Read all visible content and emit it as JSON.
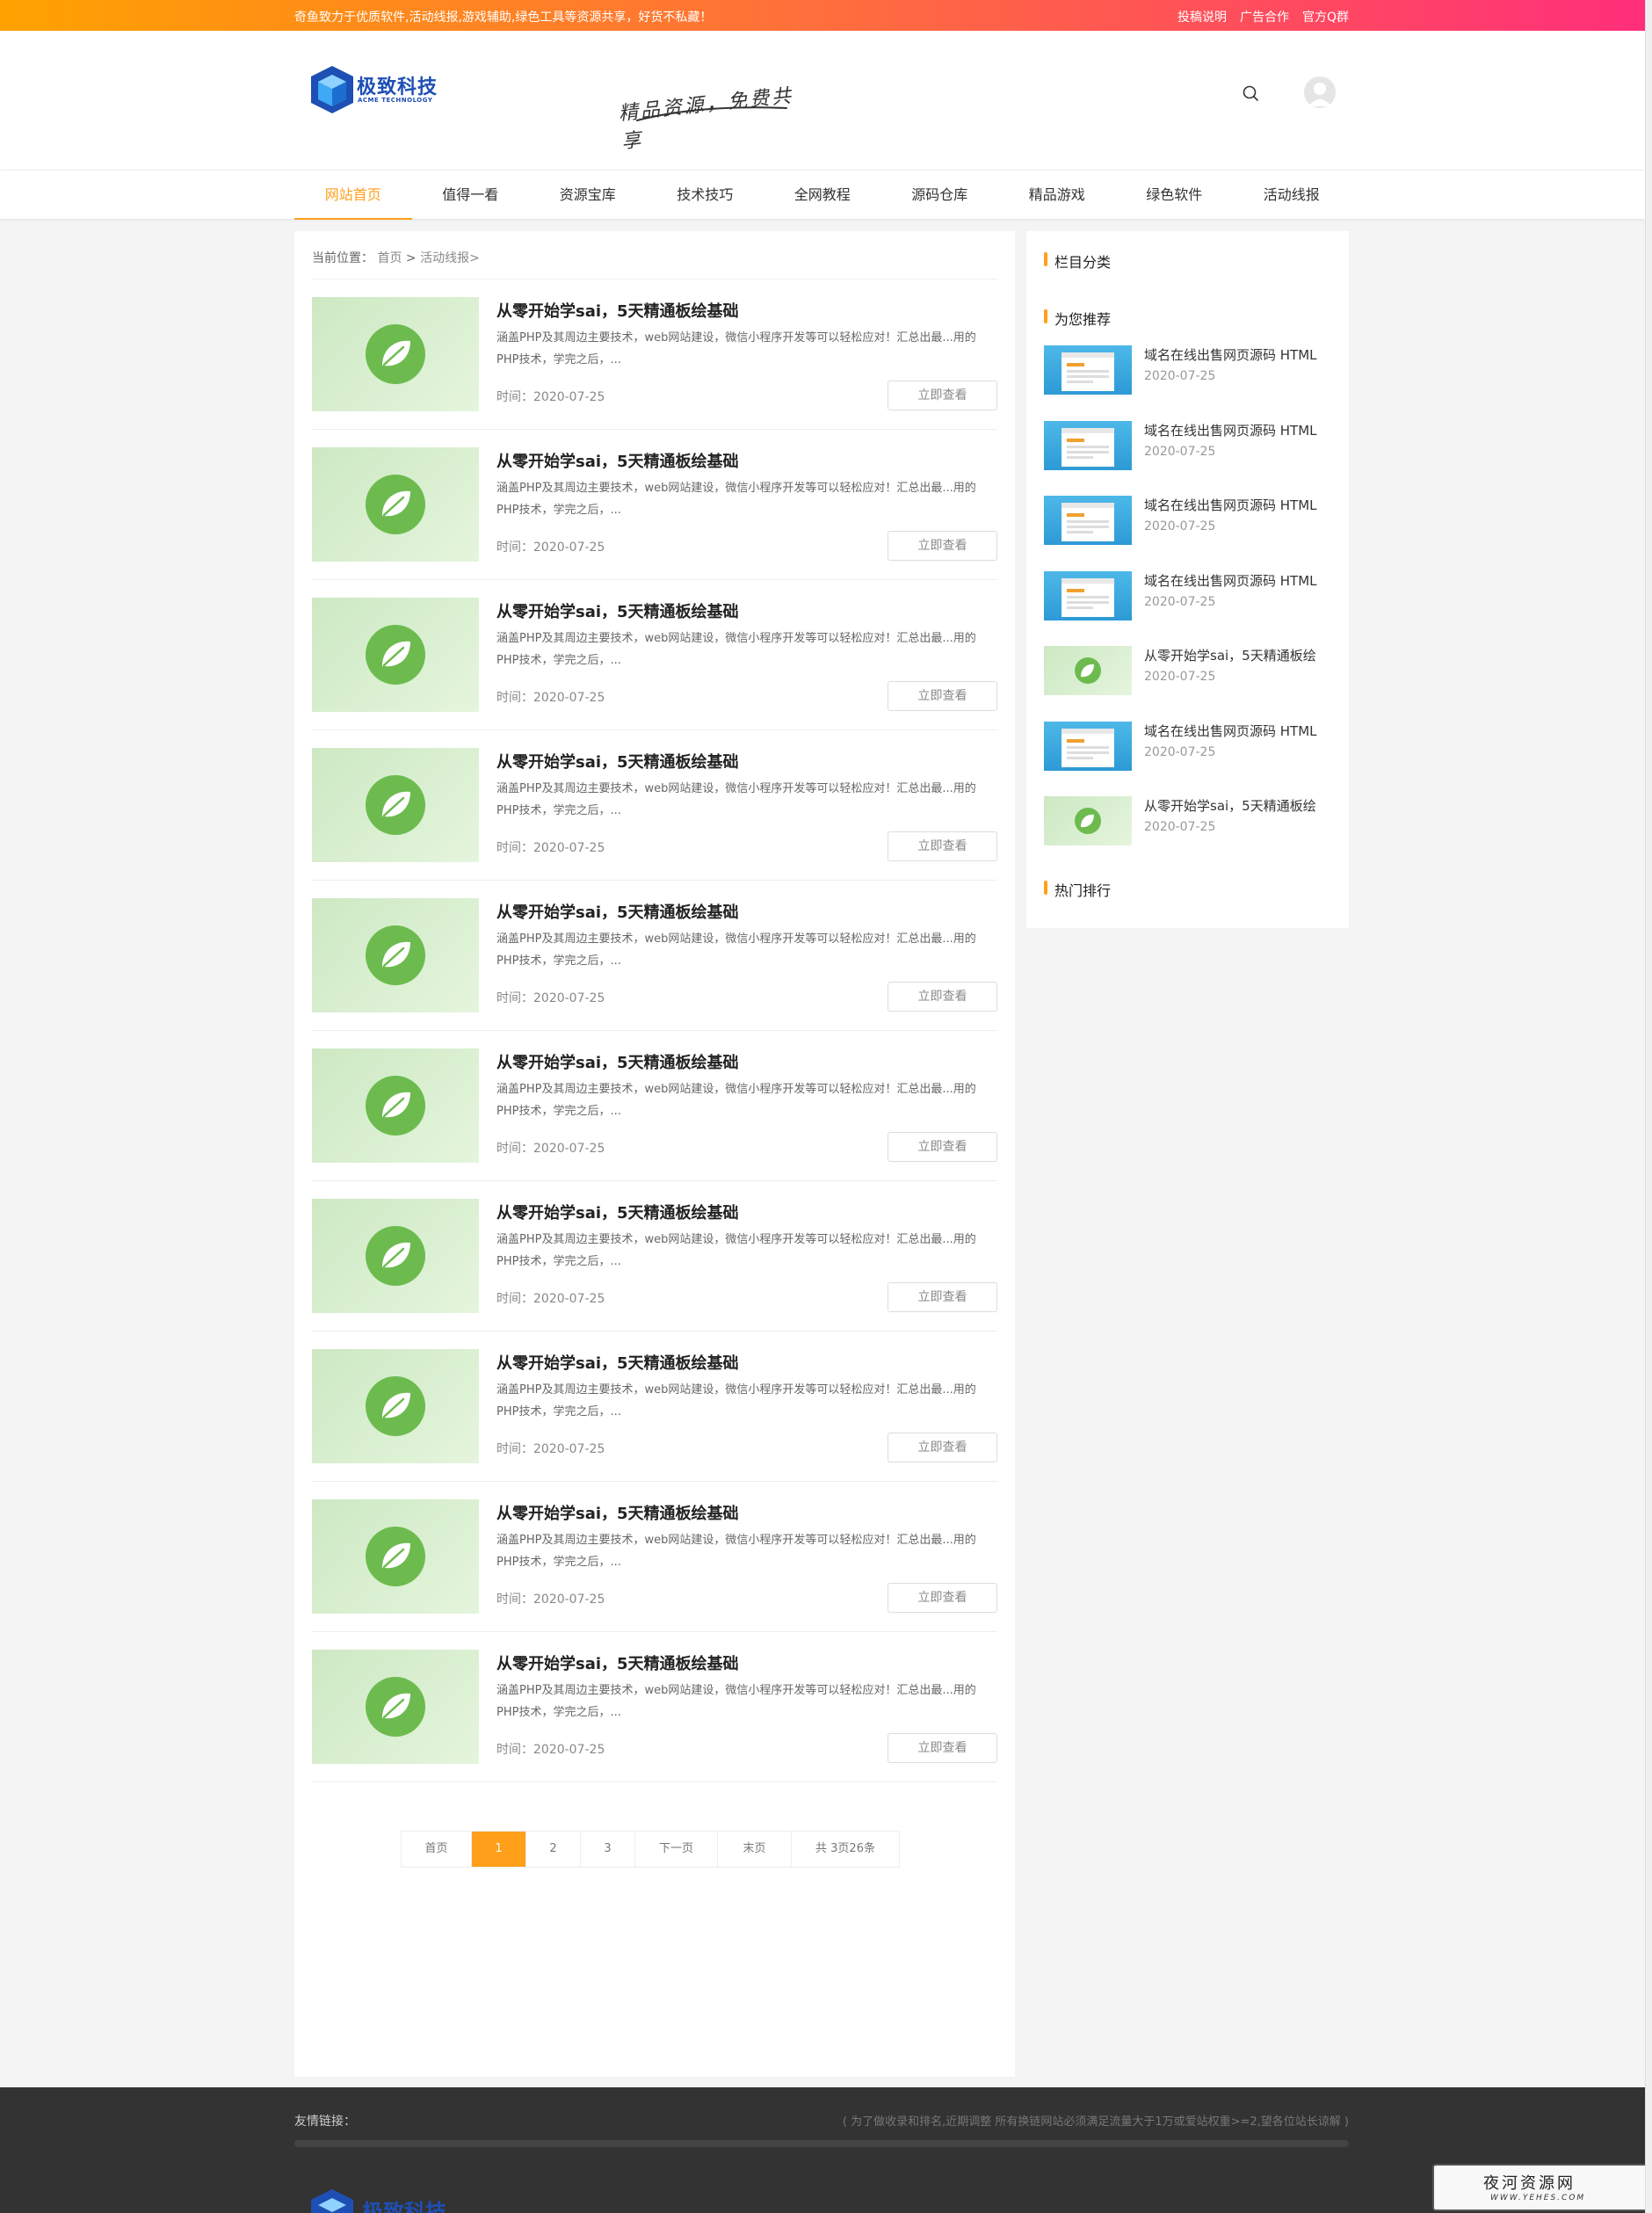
{
  "topbar": {
    "slogan": "奇鱼致力于优质软件,活动线报,游戏辅助,绿色工具等资源共享，好货不私藏！",
    "links": [
      "投稿说明",
      "广告合作",
      "官方Q群"
    ]
  },
  "header": {
    "logo_text": "极致科技",
    "logo_sub": "ACME TECHNOLOGY",
    "slogan_art": "精品资源，免费共享"
  },
  "nav": {
    "items": [
      "网站首页",
      "值得一看",
      "资源宝库",
      "技术技巧",
      "全网教程",
      "源码仓库",
      "精品游戏",
      "绿色软件",
      "活动线报"
    ]
  },
  "breadcrumb": {
    "label": "当前位置：",
    "home": "首页",
    "sep": ">",
    "current": "活动线报>"
  },
  "posts": [
    {
      "title": "从零开始学sai，5天精通板绘基础",
      "desc": "涵盖PHP及其周边主要技术，web网站建设，微信小程序开发等可以轻松应对！汇总出最...用的PHP技术，学完之后，...",
      "time": "时间：2020-07-25",
      "button": "立即查看"
    },
    {
      "title": "从零开始学sai，5天精通板绘基础",
      "desc": "涵盖PHP及其周边主要技术，web网站建设，微信小程序开发等可以轻松应对！汇总出最...用的PHP技术，学完之后，...",
      "time": "时间：2020-07-25",
      "button": "立即查看"
    },
    {
      "title": "从零开始学sai，5天精通板绘基础",
      "desc": "涵盖PHP及其周边主要技术，web网站建设，微信小程序开发等可以轻松应对！汇总出最...用的PHP技术，学完之后，...",
      "time": "时间：2020-07-25",
      "button": "立即查看"
    },
    {
      "title": "从零开始学sai，5天精通板绘基础",
      "desc": "涵盖PHP及其周边主要技术，web网站建设，微信小程序开发等可以轻松应对！汇总出最...用的PHP技术，学完之后，...",
      "time": "时间：2020-07-25",
      "button": "立即查看"
    },
    {
      "title": "从零开始学sai，5天精通板绘基础",
      "desc": "涵盖PHP及其周边主要技术，web网站建设，微信小程序开发等可以轻松应对！汇总出最...用的PHP技术，学完之后，...",
      "time": "时间：2020-07-25",
      "button": "立即查看"
    },
    {
      "title": "从零开始学sai，5天精通板绘基础",
      "desc": "涵盖PHP及其周边主要技术，web网站建设，微信小程序开发等可以轻松应对！汇总出最...用的PHP技术，学完之后，...",
      "time": "时间：2020-07-25",
      "button": "立即查看"
    },
    {
      "title": "从零开始学sai，5天精通板绘基础",
      "desc": "涵盖PHP及其周边主要技术，web网站建设，微信小程序开发等可以轻松应对！汇总出最...用的PHP技术，学完之后，...",
      "time": "时间：2020-07-25",
      "button": "立即查看"
    },
    {
      "title": "从零开始学sai，5天精通板绘基础",
      "desc": "涵盖PHP及其周边主要技术，web网站建设，微信小程序开发等可以轻松应对！汇总出最...用的PHP技术，学完之后，...",
      "time": "时间：2020-07-25",
      "button": "立即查看"
    },
    {
      "title": "从零开始学sai，5天精通板绘基础",
      "desc": "涵盖PHP及其周边主要技术，web网站建设，微信小程序开发等可以轻松应对！汇总出最...用的PHP技术，学完之后，...",
      "time": "时间：2020-07-25",
      "button": "立即查看"
    },
    {
      "title": "从零开始学sai，5天精通板绘基础",
      "desc": "涵盖PHP及其周边主要技术，web网站建设，微信小程序开发等可以轻松应对！汇总出最...用的PHP技术，学完之后，...",
      "time": "时间：2020-07-25",
      "button": "立即查看"
    }
  ],
  "pagination": {
    "items": [
      "首页",
      "1",
      "2",
      "3",
      "下一页",
      "末页",
      "共 3页26条"
    ],
    "current": "1"
  },
  "sidebar": {
    "categories_title": "栏目分类",
    "recommend_title": "为您推荐",
    "hot_title": "热门排行",
    "recommend": [
      {
        "title": "域名在线出售网页源码 HTML",
        "date": "2020-07-25",
        "thumb": "blue"
      },
      {
        "title": "域名在线出售网页源码 HTML",
        "date": "2020-07-25",
        "thumb": "blue"
      },
      {
        "title": "域名在线出售网页源码 HTML",
        "date": "2020-07-25",
        "thumb": "blue"
      },
      {
        "title": "域名在线出售网页源码 HTML",
        "date": "2020-07-25",
        "thumb": "blue"
      },
      {
        "title": "从零开始学sai，5天精通板绘",
        "date": "2020-07-25",
        "thumb": "green"
      },
      {
        "title": "域名在线出售网页源码 HTML",
        "date": "2020-07-25",
        "thumb": "blue"
      },
      {
        "title": "从零开始学sai，5天精通板绘",
        "date": "2020-07-25",
        "thumb": "green"
      }
    ]
  },
  "footer": {
    "friend_label": "友情链接：",
    "friend_note": "( 为了做收录和排名,近期调整 所有换链网站必须满足流量大于1万或爱站权重>=2,望各位站长谅解 )",
    "logo_text": "极致科技"
  },
  "watermark": {
    "line1": "夜河资源网",
    "line2": "WWW.YEHES.COM"
  },
  "colors": {
    "accent": "#ff9f1a",
    "topbar_start": "#ffa200",
    "topbar_end": "#ff2f7a",
    "footer_bg": "#333333",
    "logo_blue": "#1e4fb4"
  }
}
